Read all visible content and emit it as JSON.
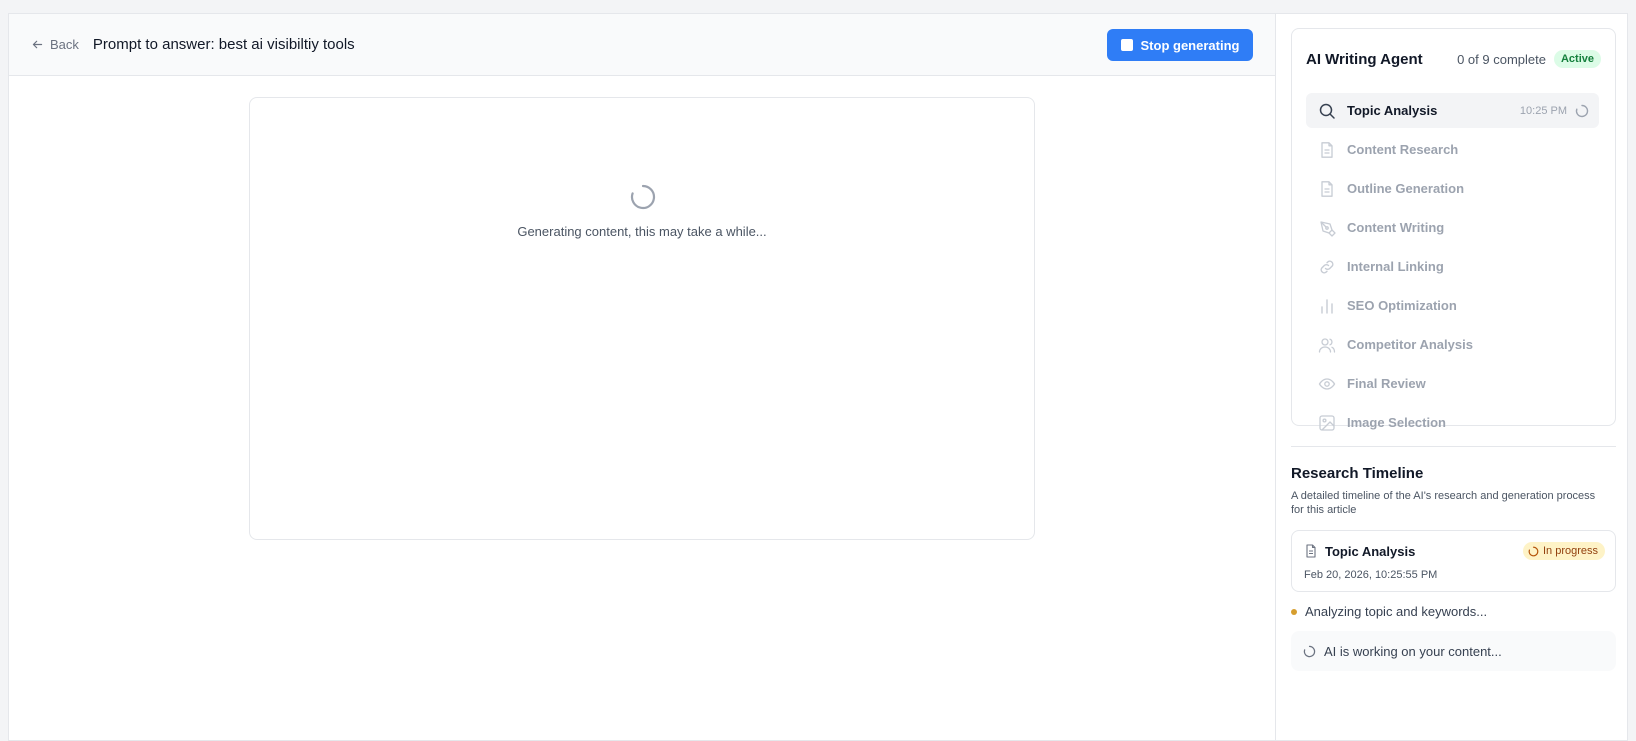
{
  "header": {
    "back_label": "Back",
    "title": "Prompt to answer: best ai visibiltiy tools",
    "stop_label": "Stop generating"
  },
  "main": {
    "generating_text": "Generating content, this may take a while..."
  },
  "agent": {
    "title": "AI Writing Agent",
    "progress": "0 of 9 complete",
    "status_badge": "Active",
    "steps": [
      {
        "label": "Topic Analysis",
        "time": "10:25 PM",
        "icon": "search-icon"
      },
      {
        "label": "Content Research",
        "icon": "document-icon"
      },
      {
        "label": "Outline Generation",
        "icon": "document-icon"
      },
      {
        "label": "Content Writing",
        "icon": "pen-icon"
      },
      {
        "label": "Internal Linking",
        "icon": "link-icon"
      },
      {
        "label": "SEO Optimization",
        "icon": "bar-chart-icon"
      },
      {
        "label": "Competitor Analysis",
        "icon": "users-icon"
      },
      {
        "label": "Final Review",
        "icon": "eye-icon"
      },
      {
        "label": "Image Selection",
        "icon": "image-icon"
      }
    ]
  },
  "timeline": {
    "title": "Research Timeline",
    "description": "A detailed timeline of the AI's research and generation process for this article",
    "entry": {
      "step": "Topic Analysis",
      "status": "In progress",
      "timestamp": "Feb 20, 2026, 10:25:55 PM"
    },
    "status_line": "Analyzing topic and keywords...",
    "working_text": "AI is working on your content..."
  },
  "colors": {
    "accent": "#2f7df6",
    "active_badge_bg": "#dcfce7",
    "active_badge_text": "#15803d",
    "progress_badge_bg": "#fef3c7",
    "status_dot": "#d69e2e"
  }
}
